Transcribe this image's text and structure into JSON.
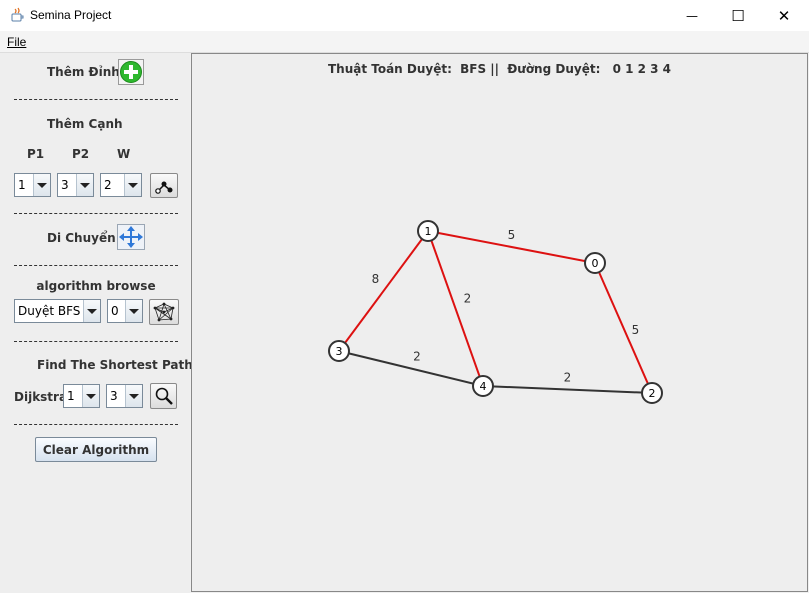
{
  "window": {
    "title": "Semina Project",
    "minimize": "—",
    "maximize": "☐",
    "close": "✕"
  },
  "menu": {
    "file": "File"
  },
  "sidebar": {
    "add_vertex_label": "Thêm Đỉnh",
    "add_edge_label": "Thêm Cạnh",
    "p1_label": "P1",
    "p2_label": "P2",
    "w_label": "W",
    "p1_value": "1",
    "p2_value": "3",
    "w_value": "2",
    "move_label": "Di Chuyển",
    "algorithm_label": "algorithm browse",
    "algorithm_value": "Duyệt BFS",
    "start_value": "0",
    "shortest_label": "Find The Shortest Path",
    "dijkstra_label": "Dijkstra",
    "from_value": "1",
    "to_value": "3",
    "clear_button": "Clear Algorithm",
    "separator": "------------------------------------"
  },
  "status": {
    "algorithm_caption": "Thuật Toán Duyệt:",
    "algorithm_name": "BFS ||",
    "path_caption": "Đường Duyệt:",
    "path_value": "0 1 2 3 4"
  },
  "graph": {
    "nodes": [
      {
        "id": "0",
        "label": "0"
      },
      {
        "id": "1",
        "label": "1"
      },
      {
        "id": "2",
        "label": "2"
      },
      {
        "id": "3",
        "label": "3"
      },
      {
        "id": "4",
        "label": "4"
      }
    ],
    "edges": [
      {
        "from": "1",
        "to": "0",
        "weight": "5",
        "highlighted": true
      },
      {
        "from": "1",
        "to": "3",
        "weight": "8",
        "highlighted": true
      },
      {
        "from": "1",
        "to": "4",
        "weight": "2",
        "highlighted": true
      },
      {
        "from": "0",
        "to": "2",
        "weight": "5",
        "highlighted": true
      },
      {
        "from": "3",
        "to": "4",
        "weight": "2",
        "highlighted": false
      },
      {
        "from": "4",
        "to": "2",
        "weight": "2",
        "highlighted": false
      }
    ],
    "colors": {
      "highlight": "#dd1111",
      "normal": "#333333",
      "node_stroke": "#333333",
      "node_fill": "#ffffff"
    }
  }
}
